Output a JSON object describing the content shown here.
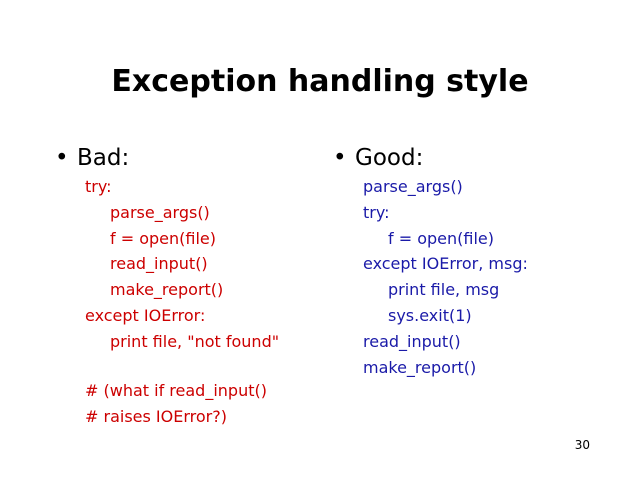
{
  "slide": {
    "title": "Exception handling style",
    "page_number": "30",
    "colors": {
      "bad_code": "#cc0000",
      "good_code": "#1a1aa8",
      "text": "#000000"
    }
  },
  "bad": {
    "bullet_label": "Bad:",
    "code_lines": [
      {
        "text": "try:",
        "indent": 0
      },
      {
        "text": "parse_args()",
        "indent": 1
      },
      {
        "text": "f = open(file)",
        "indent": 1
      },
      {
        "text": "read_input()",
        "indent": 1
      },
      {
        "text": "make_report()",
        "indent": 1
      },
      {
        "text": "except IOError:",
        "indent": 0
      },
      {
        "text": "print file, \"not found\"",
        "indent": 1
      }
    ],
    "comment_lines": [
      "# (what if read_input()",
      "# raises IOError?)"
    ]
  },
  "good": {
    "bullet_label": "Good:",
    "code_lines": [
      {
        "text": "parse_args()",
        "indent": 0
      },
      {
        "text": "try:",
        "indent": 0
      },
      {
        "text": "f = open(file)",
        "indent": 1
      },
      {
        "text": "except IOError, msg:",
        "indent": 0
      },
      {
        "text": "print file, msg",
        "indent": 1
      },
      {
        "text": "sys.exit(1)",
        "indent": 1
      },
      {
        "text": "read_input()",
        "indent": 0
      },
      {
        "text": "make_report()",
        "indent": 0
      }
    ]
  }
}
